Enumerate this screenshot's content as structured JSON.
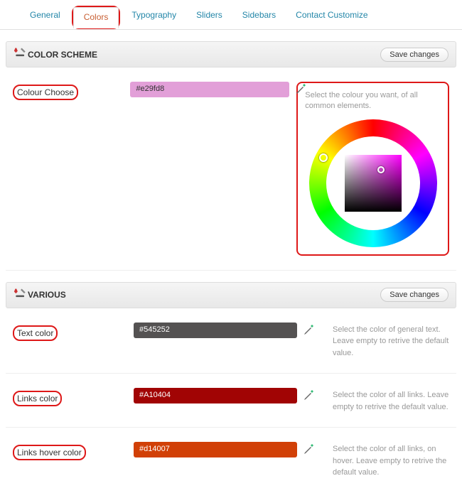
{
  "tabs": [
    {
      "label": "General"
    },
    {
      "label": "Colors",
      "active": true
    },
    {
      "label": "Typography"
    },
    {
      "label": "Sliders"
    },
    {
      "label": "Sidebars"
    },
    {
      "label": "Contact Customize"
    }
  ],
  "sections": {
    "scheme": {
      "title": "COLOR SCHEME",
      "save_label": "Save changes",
      "options": {
        "colour_choose": {
          "label": "Colour Choose",
          "value": "#e29fd8",
          "help": "Select the colour you want, of all common elements."
        }
      }
    },
    "various": {
      "title": "VARIOUS",
      "save_label": "Save changes",
      "options": {
        "text_color": {
          "label": "Text color",
          "value": "#545252",
          "help": "Select the color of general text. Leave empty to retrive the default value."
        },
        "links_color": {
          "label": "Links color",
          "value": "#A10404",
          "help": "Select the color of all links. Leave empty to retrive the default value."
        },
        "links_hover_color": {
          "label": "Links hover color",
          "value": "#d14007",
          "help": "Select the color of all links, on hover. Leave empty to retrive the default value."
        }
      }
    }
  }
}
